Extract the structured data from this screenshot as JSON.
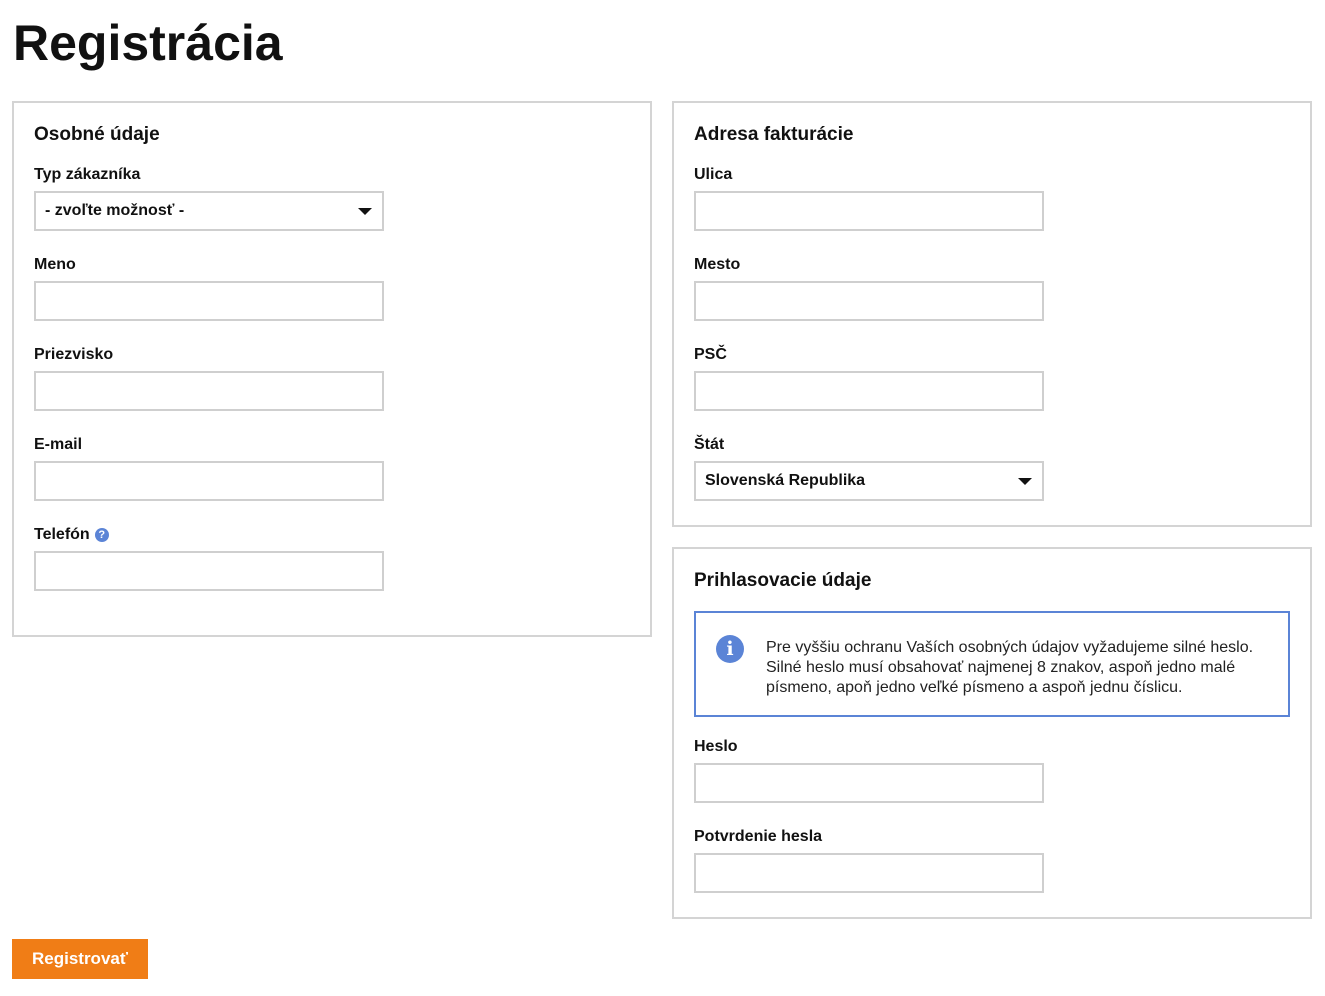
{
  "page": {
    "title": "Registrácia"
  },
  "personal": {
    "title": "Osobné údaje",
    "customer_type_label": "Typ zákazníka",
    "customer_type_value": "- zvoľte možnosť -",
    "first_name_label": "Meno",
    "first_name_value": "",
    "last_name_label": "Priezvisko",
    "last_name_value": "",
    "email_label": "E-mail",
    "email_value": "",
    "phone_label": "Telefón",
    "phone_help_glyph": "?",
    "phone_value": ""
  },
  "billing": {
    "title": "Adresa fakturácie",
    "street_label": "Ulica",
    "street_value": "",
    "city_label": "Mesto",
    "city_value": "",
    "zip_label": "PSČ",
    "zip_value": "",
    "country_label": "Štát",
    "country_value": "Slovenská Republika"
  },
  "login": {
    "title": "Prihlasovacie údaje",
    "info_glyph": "i",
    "info_text": "Pre vyššiu ochranu Vaších osobných údajov vyžadujeme silné heslo. Silné heslo musí obsahovať najmenej 8 znakov, aspoň jedno malé písmeno, apoň jedno veľké písmeno a aspoň jednu číslicu.",
    "password_label": "Heslo",
    "password_value": "",
    "password_confirm_label": "Potvrdenie hesla",
    "password_confirm_value": ""
  },
  "actions": {
    "register_label": "Registrovať"
  },
  "colors": {
    "accent": "#f07d16",
    "info": "#5b84d6",
    "border": "#d4d4d4"
  },
  "icons": {
    "help": "question-circle-icon",
    "info": "info-circle-icon",
    "caret": "chevron-down-icon"
  }
}
